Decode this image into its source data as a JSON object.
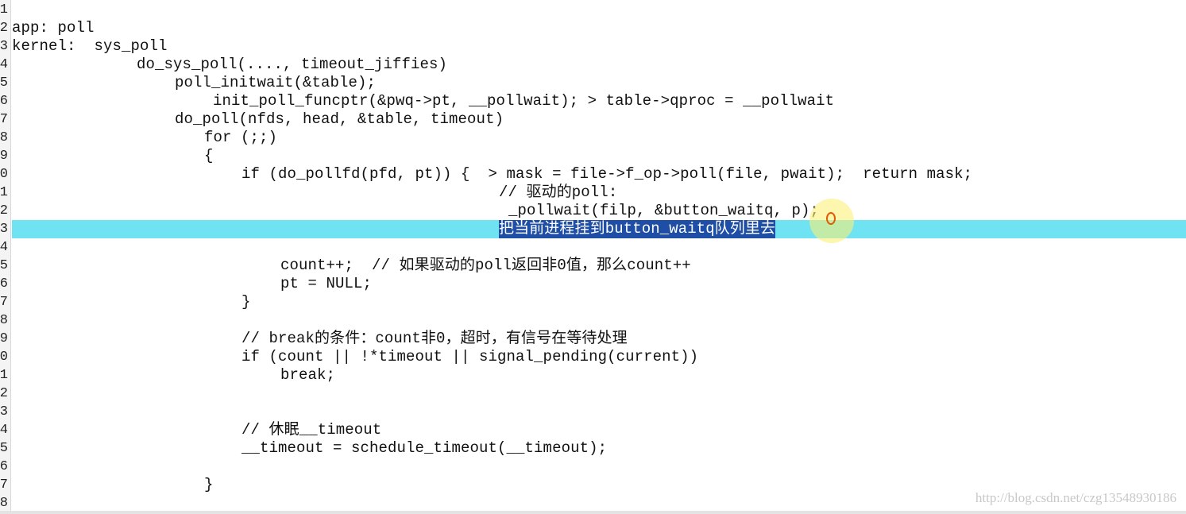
{
  "editor": {
    "highlight_color": "#6fe3f1",
    "selection_color": "#1f4ea6",
    "lines": [
      {
        "num": "1",
        "text": ""
      },
      {
        "num": "2",
        "text": "app: poll"
      },
      {
        "num": "3",
        "text": "kernel:  sys_poll"
      },
      {
        "num": "4",
        "text": "do_sys_poll(...., timeout_jiffies)"
      },
      {
        "num": "5",
        "text": "poll_initwait(&table);"
      },
      {
        "num": "6",
        "text": "init_poll_funcptr(&pwq->pt, __pollwait); > table->qproc = __pollwait"
      },
      {
        "num": "7",
        "text": "do_poll(nfds, head, &table, timeout)"
      },
      {
        "num": "8",
        "text": "for (;;)"
      },
      {
        "num": "9",
        "text": "{"
      },
      {
        "num": "0",
        "text": "if (do_pollfd(pfd, pt)) {  > mask = file->f_op->poll(file, pwait);  return mask;"
      },
      {
        "num": "1",
        "text": "// 驱动的poll:"
      },
      {
        "num": "2",
        "text": "_pollwait(filp, &button_waitq, p);"
      },
      {
        "num": "3",
        "text": "把当前进程挂到button_waitq队列里去"
      },
      {
        "num": "4",
        "text": ""
      },
      {
        "num": "5",
        "text": "count++;  // 如果驱动的poll返回非0值，那么count++"
      },
      {
        "num": "6",
        "text": "pt = NULL;"
      },
      {
        "num": "7",
        "text": "}"
      },
      {
        "num": "8",
        "text": ""
      },
      {
        "num": "9",
        "text": "// break的条件：count非0，超时，有信号在等待处理"
      },
      {
        "num": "0",
        "text": "if (count || !*timeout || signal_pending(current))"
      },
      {
        "num": "1",
        "text": "break;"
      },
      {
        "num": "2",
        "text": ""
      },
      {
        "num": "3",
        "text": ""
      },
      {
        "num": "4",
        "text": "// 休眠__timeout"
      },
      {
        "num": "5",
        "text": "__timeout = schedule_timeout(__timeout);"
      },
      {
        "num": "6",
        "text": ""
      },
      {
        "num": "7",
        "text": "}"
      },
      {
        "num": "8",
        "text": ""
      }
    ]
  },
  "watermark": "http://blog.csdn.net/czg13548930186"
}
